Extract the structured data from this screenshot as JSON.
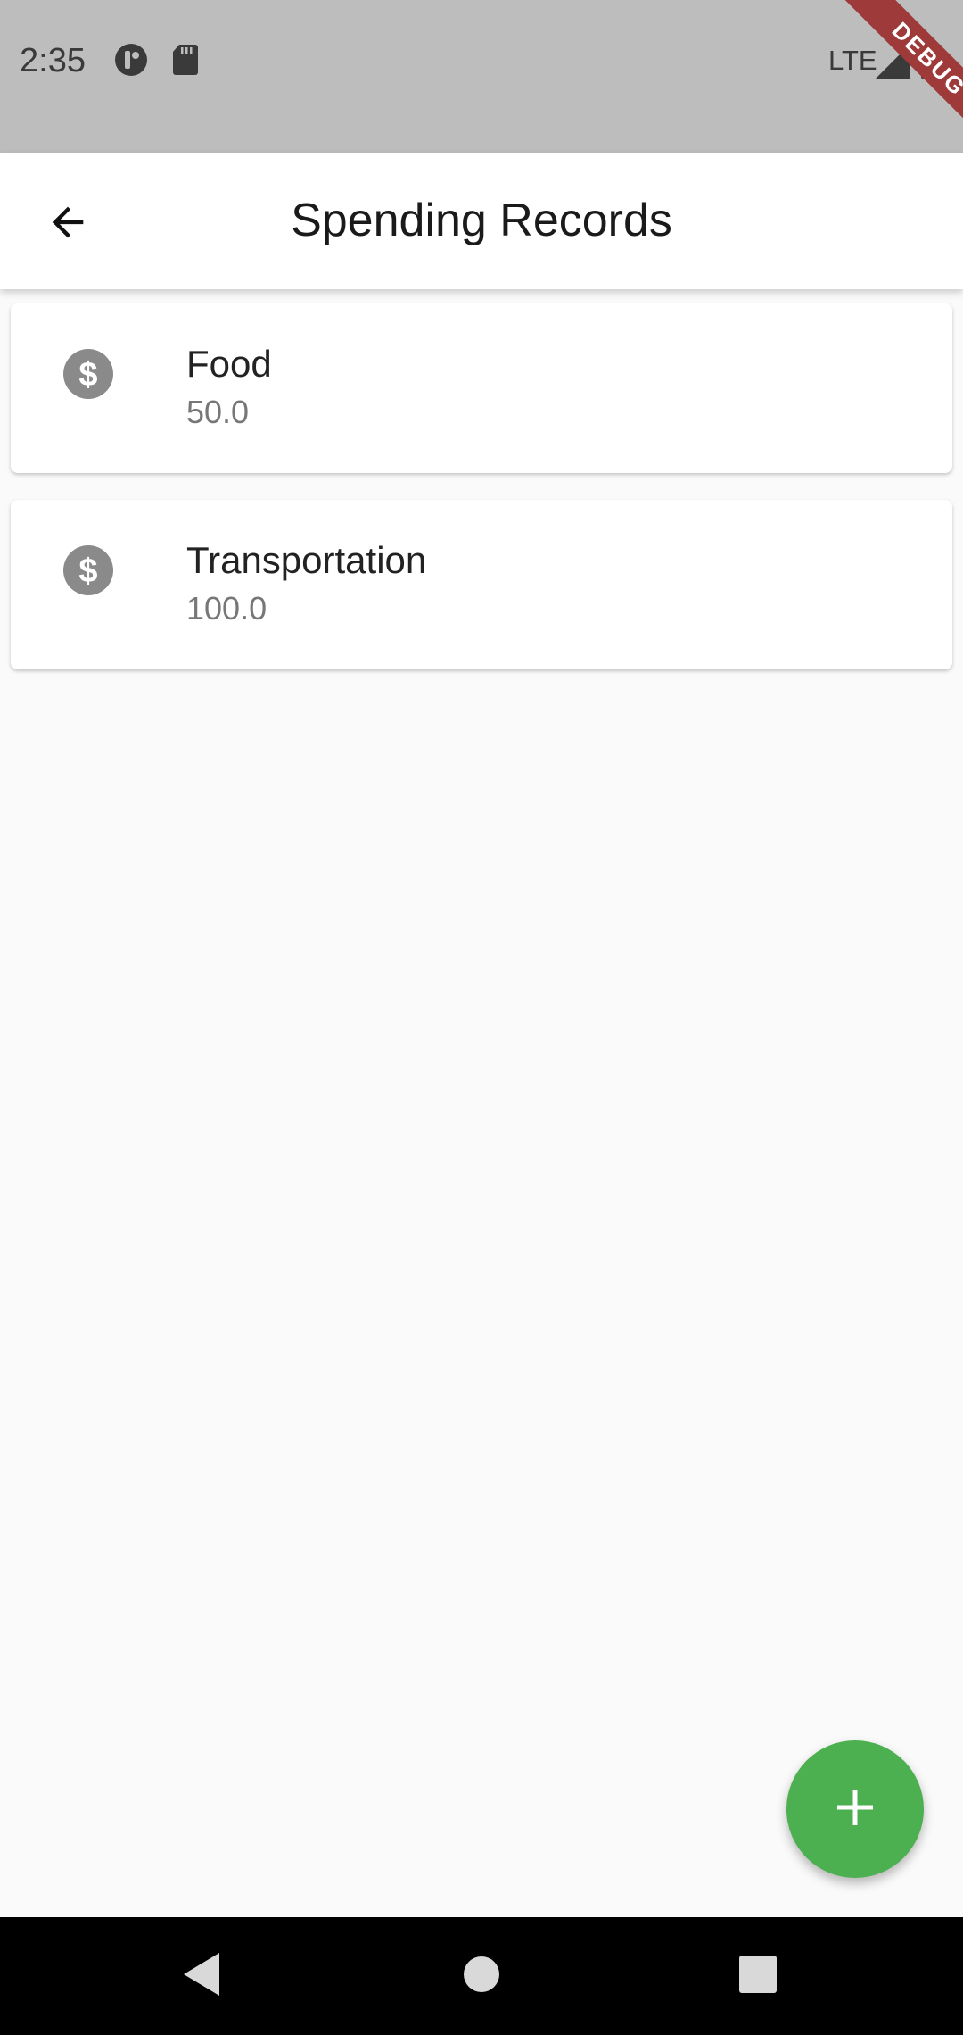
{
  "status_bar": {
    "time": "2:35",
    "network": "LTE",
    "debug_label": "DEBUG",
    "icons": [
      "podcast-icon",
      "sd-card-icon",
      "signal-icon",
      "battery-icon"
    ]
  },
  "app_bar": {
    "title": "Spending Records",
    "back_icon": "arrow-back-icon"
  },
  "records": [
    {
      "title": "Food",
      "amount": "50.0",
      "icon": "dollar-circle-icon"
    },
    {
      "title": "Transportation",
      "amount": "100.0",
      "icon": "dollar-circle-icon"
    }
  ],
  "fab": {
    "icon": "plus-icon",
    "color": "#4caf50"
  },
  "nav_bar": {
    "icons": [
      "nav-back-icon",
      "nav-home-icon",
      "nav-recents-icon"
    ]
  },
  "colors": {
    "status_bar": "#bdbdbd",
    "background": "#fafafa",
    "accent": "#4caf50",
    "icon_gray": "#8a8a8a"
  }
}
